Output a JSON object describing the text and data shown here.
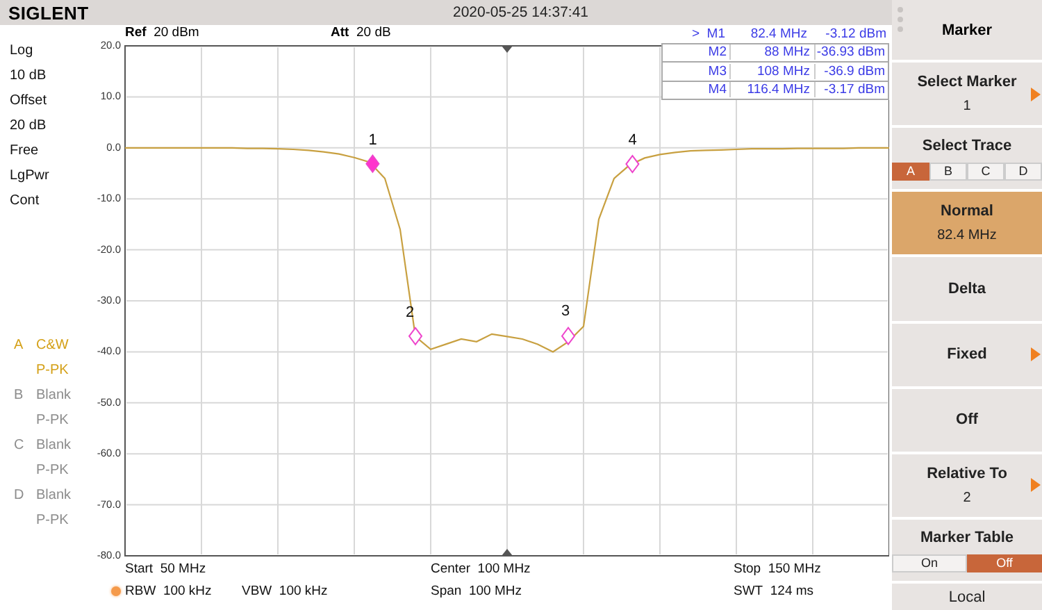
{
  "top_bar": {
    "logo": "SIGLENT",
    "datetime": "2020-05-25 14:37:41"
  },
  "left_panel": {
    "settings": [
      "Log",
      "10 dB",
      "Offset",
      "20 dB",
      "Free",
      "LgPwr",
      "Cont"
    ],
    "traces": [
      {
        "letter": "A",
        "mode": "C&W",
        "detector": "P-PK",
        "active": true
      },
      {
        "letter": "B",
        "mode": "Blank",
        "detector": "P-PK",
        "active": false
      },
      {
        "letter": "C",
        "mode": "Blank",
        "detector": "P-PK",
        "active": false
      },
      {
        "letter": "D",
        "mode": "Blank",
        "detector": "P-PK",
        "active": false
      }
    ]
  },
  "header": [
    {
      "label": "Ref",
      "value": "20 dBm"
    },
    {
      "label": "Att",
      "value": "20 dB"
    }
  ],
  "marker_table": {
    "pointer": ">",
    "rows": [
      {
        "name": "M1",
        "frequency": "82.4 MHz",
        "amplitude": "-3.12 dBm",
        "selected": true
      },
      {
        "name": "M2",
        "frequency": "88 MHz",
        "amplitude": "-36.93 dBm",
        "selected": false
      },
      {
        "name": "M3",
        "frequency": "108 MHz",
        "amplitude": "-36.9 dBm",
        "selected": false
      },
      {
        "name": "M4",
        "frequency": "116.4 MHz",
        "amplitude": "-3.17 dBm",
        "selected": false
      }
    ]
  },
  "plot": {
    "chart_data": {
      "type": "line",
      "ylim": [
        -80,
        20
      ],
      "yticks": [
        {
          "value": 20,
          "label": "20.0"
        },
        {
          "value": 10,
          "label": "10.0"
        },
        {
          "value": 0,
          "label": "0.0"
        },
        {
          "value": -10,
          "label": "-10.0"
        },
        {
          "value": -20,
          "label": "-20.0"
        },
        {
          "value": -30,
          "label": "-30.0"
        },
        {
          "value": -40,
          "label": "-40.0"
        },
        {
          "value": -50,
          "label": "-50.0"
        },
        {
          "value": -60,
          "label": "-60.0"
        },
        {
          "value": -70,
          "label": "-70.0"
        },
        {
          "value": -80,
          "label": "-80.0"
        }
      ],
      "categories": [
        null,
        null,
        null,
        null,
        null,
        null,
        null,
        null,
        null,
        null,
        null,
        null,
        null,
        null,
        null,
        null,
        null,
        null,
        null,
        null,
        null,
        null,
        null,
        null,
        null,
        null,
        null,
        null,
        null,
        null,
        null,
        null,
        null,
        null,
        null,
        null,
        null,
        null,
        null,
        null,
        null,
        null,
        null,
        null,
        null,
        null,
        null,
        null,
        null,
        null,
        null
      ],
      "series": [
        {
          "color": "#c8a040",
          "values": [
            0,
            0,
            0,
            0,
            0,
            0,
            0,
            0,
            -0.1,
            -0.1,
            -0.2,
            -0.3,
            -0.5,
            -0.8,
            -1.2,
            -1.9,
            -2.8,
            -6,
            -16,
            -37,
            -39.5,
            -38.5,
            -37.5,
            -38,
            -36.5,
            -37,
            -37.5,
            -38.5,
            -40,
            -38,
            -35,
            -14,
            -6,
            -3.4,
            -2,
            -1.3,
            -0.9,
            -0.6,
            -0.5,
            -0.4,
            -0.3,
            -0.2,
            -0.2,
            -0.2,
            -0.1,
            -0.1,
            -0.1,
            -0.1,
            0,
            0,
            0
          ]
        }
      ],
      "grid": true,
      "annotations": [
        {
          "text": "1",
          "y": -3.12
        },
        {
          "text": "2",
          "y": -36.93
        },
        {
          "text": "3",
          "y": -36.9
        },
        {
          "text": "4",
          "y": -3.17
        }
      ]
    }
  },
  "bottom": [
    [
      {
        "label": "Start",
        "value": "50 MHz"
      },
      {
        "label": "Center",
        "value": "100 MHz"
      },
      {
        "label": "Stop",
        "value": "150 MHz"
      }
    ],
    [
      {
        "label": "RBW",
        "value": "100 kHz",
        "dot": true
      },
      {
        "label": "VBW",
        "value": "100 kHz"
      },
      {
        "label": "Span",
        "value": "100 MHz"
      },
      {
        "label": "SWT",
        "value": "124 ms"
      }
    ]
  ],
  "softkeys": [
    {
      "kind": "title",
      "label": "Marker"
    },
    {
      "kind": "button",
      "label": "Select Marker",
      "value": "1",
      "submenu": true,
      "selected": false
    },
    {
      "kind": "choice",
      "label": "Select Trace",
      "options": [
        {
          "label": "A",
          "selected": true
        },
        {
          "label": "B",
          "selected": false
        },
        {
          "label": "C",
          "selected": false
        },
        {
          "label": "D",
          "selected": false
        }
      ]
    },
    {
      "kind": "button",
      "label": "Normal",
      "value": "82.4 MHz",
      "submenu": false,
      "selected": true
    },
    {
      "kind": "button",
      "label": "Delta",
      "submenu": false,
      "selected": false
    },
    {
      "kind": "button",
      "label": "Fixed",
      "submenu": true,
      "selected": false
    },
    {
      "kind": "button",
      "label": "Off",
      "submenu": false,
      "selected": false
    },
    {
      "kind": "button",
      "label": "Relative To",
      "value": "2",
      "submenu": true,
      "selected": false
    },
    {
      "kind": "choice",
      "label": "Marker Table",
      "options": [
        {
          "label": "On",
          "selected": false
        },
        {
          "label": "Off",
          "selected": true
        }
      ]
    },
    {
      "kind": "footer",
      "label": "Local"
    }
  ]
}
